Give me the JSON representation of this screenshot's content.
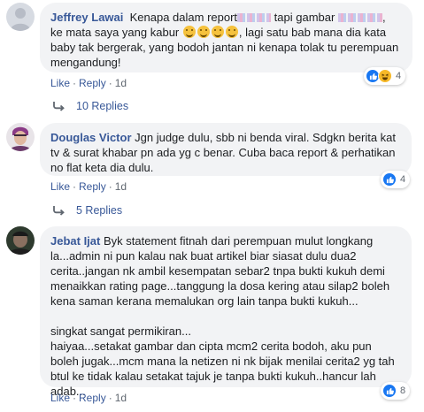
{
  "comments": [
    {
      "author": "Jeffrey Lawai",
      "lines": [
        "Kenapa dalam report",
        "tapi gambar",
        ",",
        "ke mata saya yang kabur",
        ", lagi satu bab mana dia kata",
        "baby tak bergerak, yang bodoh jantan ni kenapa tolak tu perempuan",
        "mengandung!"
      ],
      "actions": {
        "like": "Like",
        "reply": "Reply",
        "time": "1d"
      },
      "reaction_count": "4",
      "reaction_icons": [
        "like-icon",
        "haha-icon"
      ],
      "replies_label": "10 Replies"
    },
    {
      "author": "Douglas Victor",
      "text": "Jgn judge dulu, sbb ni benda viral. Sdgkn berita kat tv & surat khabar pn ada yg c benar. Cuba baca report & perhatikan no flat keta dia dulu.",
      "actions": {
        "like": "Like",
        "reply": "Reply",
        "time": "1d"
      },
      "reaction_count": "4",
      "reaction_icons": [
        "like-icon"
      ],
      "replies_label": "5 Replies"
    },
    {
      "author": "Jebat Ijat",
      "para1": "Byk statement fitnah dari perempuan mulut longkang la...admin ni pun kalau nak buat artikel biar siasat dulu dua2 cerita..jangan nk ambil kesempatan sebar2 tnpa bukti kukuh demi menaikkan rating page...tanggung la dosa kering atau silap2 boleh kena saman kerana memalukan org lain tanpa bukti kukuh...",
      "para2": "singkat sangat permikiran...",
      "para3": "haiyaa...setakat gambar dan cipta mcm2 cerita bodoh, aku pun boleh jugak...mcm mana la netizen ni nk bijak menilai cerita2 yg tah btul ke tidak kalau setakat tajuk je tanpa bukti kukuh..hancur lah adab...",
      "actions": {
        "like": "Like",
        "reply": "Reply",
        "time": "1d"
      },
      "reaction_count": "8",
      "reaction_icons": [
        "like-icon"
      ]
    }
  ],
  "colors": {
    "link": "#385898",
    "bubble": "#f2f3f5",
    "like": "#1877f2",
    "haha": "#f7b928"
  }
}
